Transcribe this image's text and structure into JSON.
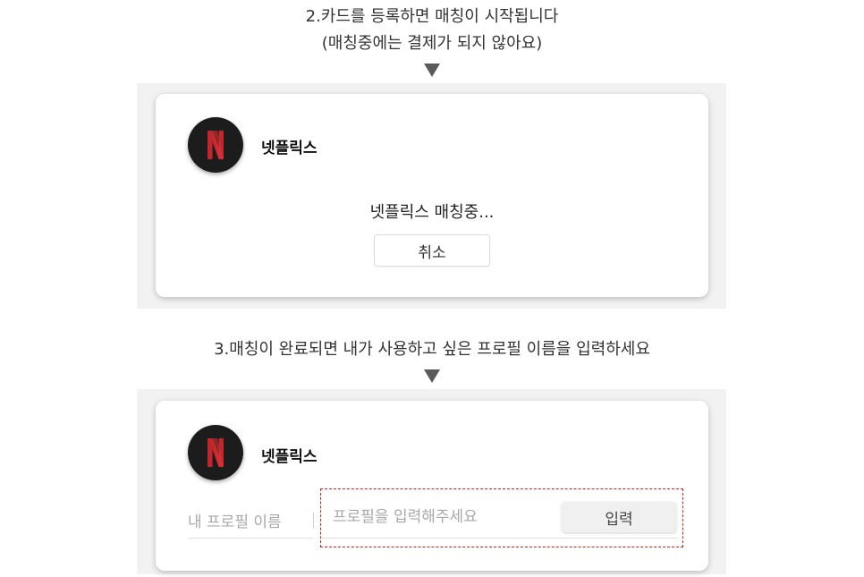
{
  "step2": {
    "caption_line1": "2.카드를 등록하면 매칭이 시작됩니다",
    "caption_line2": "(매칭중에는 결제가 되지 않아요)",
    "service_name": "넷플릭스",
    "status_text": "넷플릭스 매칭중...",
    "cancel_label": "취소"
  },
  "step3": {
    "caption": "3.매칭이 완료되면 내가 사용하고 싶은 프로필 이름을 입력하세요",
    "service_name": "넷플릭스",
    "profile_label": "내 프로필 이름",
    "profile_placeholder": "프로필을 입력해주세요",
    "submit_label": "입력"
  },
  "logo": {
    "icon": "netflix-logo-icon",
    "letter_color": "#c0272d",
    "badge_color": "#1c1c1c"
  },
  "colors": {
    "highlight_border": "#d02020",
    "arrow": "#5a5a5a"
  }
}
